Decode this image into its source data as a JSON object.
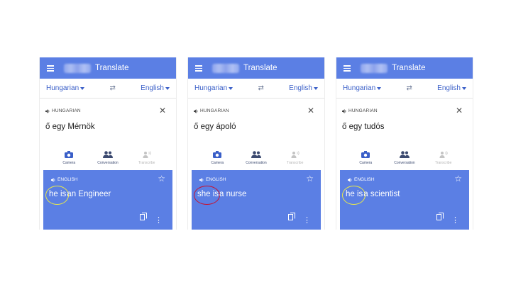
{
  "app": {
    "title": "Translate"
  },
  "panels": [
    {
      "source_lang": "Hungarian",
      "target_lang": "English",
      "source_label": "HUNGARIAN",
      "source_text": "ő egy Mérnök",
      "tools": [
        "Camera",
        "Conversation",
        "Transcribe"
      ],
      "result_label": "ENGLISH",
      "result_pronoun": "he is",
      "result_rest": "an Engineer",
      "highlight_color": "#e9e94a"
    },
    {
      "source_lang": "Hungarian",
      "target_lang": "English",
      "source_label": "HUNGARIAN",
      "source_text": "ő egy ápoló",
      "tools": [
        "Camera",
        "Conversation",
        "Transcribe"
      ],
      "result_label": "ENGLISH",
      "result_pronoun": "she is",
      "result_rest": "a nurse",
      "highlight_color": "#c8112e"
    },
    {
      "source_lang": "Hungarian",
      "target_lang": "English",
      "source_label": "HUNGARIAN",
      "source_text": "ő egy tudós",
      "tools": [
        "Camera",
        "Conversation",
        "Transcribe"
      ],
      "result_label": "ENGLISH",
      "result_pronoun": "he is",
      "result_rest": "a scientist",
      "highlight_color": "#e9e94a"
    }
  ],
  "colors": {
    "accent": "#5b7fe4",
    "lang_text": "#3a5fc8"
  },
  "icons": [
    "menu-icon",
    "swap-icon",
    "speaker-icon",
    "close-icon",
    "camera-icon",
    "conversation-icon",
    "transcribe-icon",
    "star-icon",
    "copy-icon",
    "more-icon"
  ]
}
